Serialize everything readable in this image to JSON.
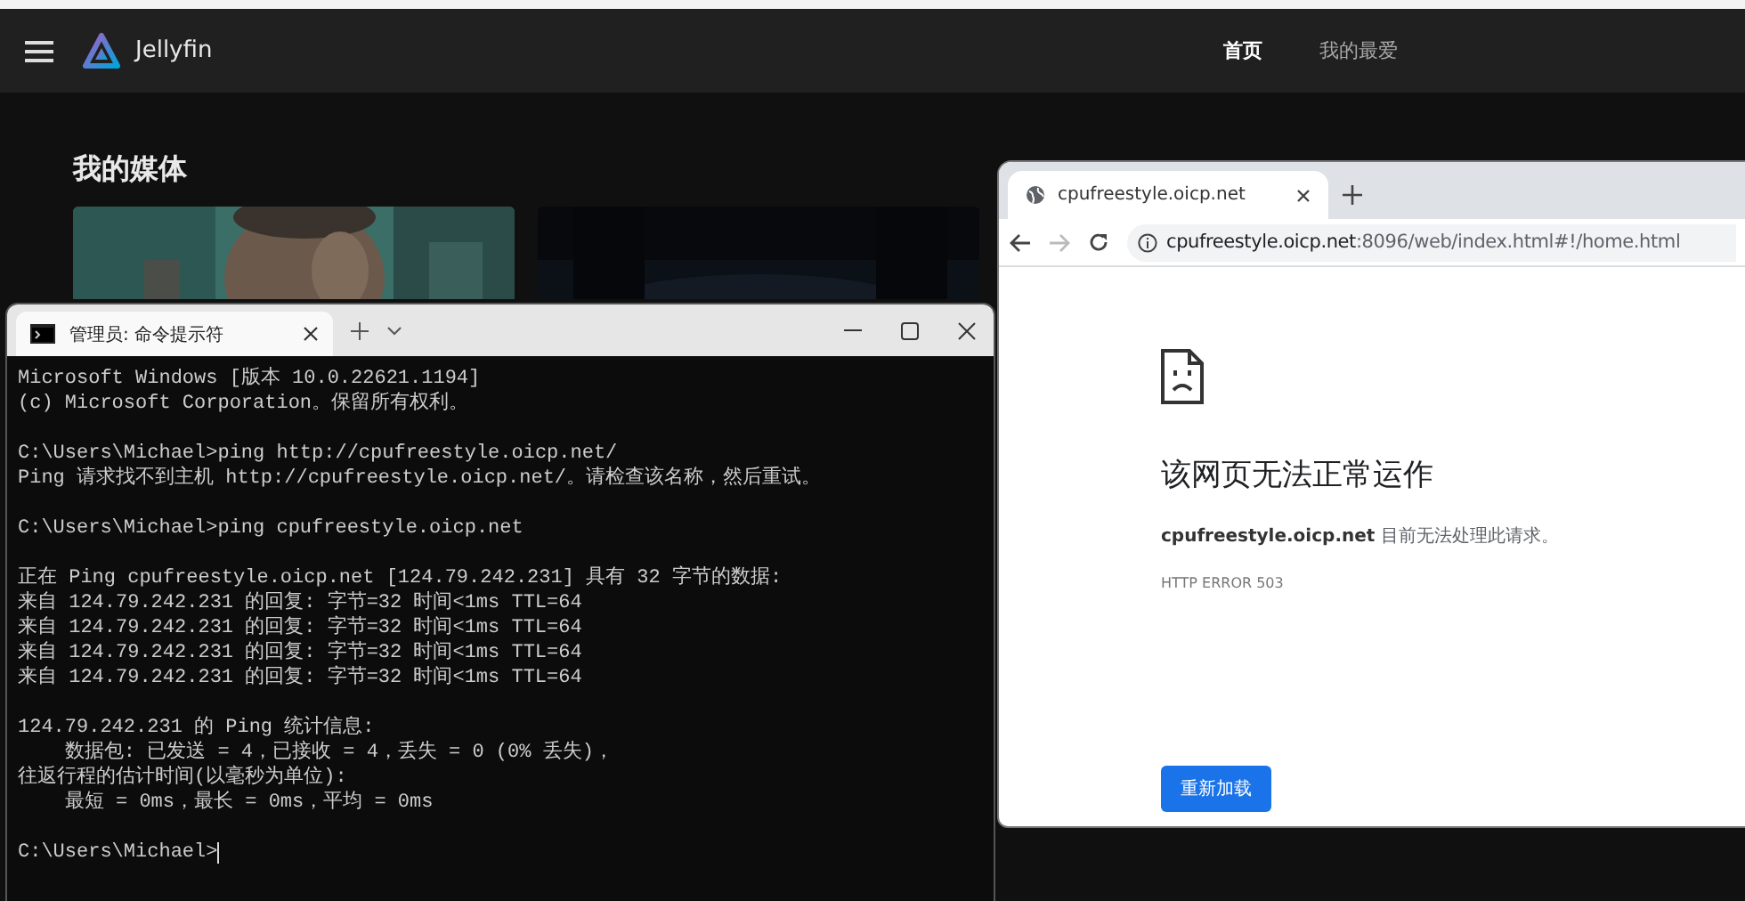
{
  "app": {
    "name": "Jellyfin",
    "nav": [
      {
        "label": "首页",
        "selected": true
      },
      {
        "label": "我的最爱",
        "selected": false
      }
    ],
    "section_title": "我的媒体"
  },
  "terminal": {
    "tab_title": "管理员: 命令提示符",
    "blocks": [
      [
        "Microsoft Windows [版本 10.0.22621.1194]",
        "(c) Microsoft Corporation。保留所有权利。"
      ],
      [
        "C:\\Users\\Michael>ping http://cpufreestyle.oicp.net/",
        "Ping 请求找不到主机 http://cpufreestyle.oicp.net/。请检查该名称，然后重试。"
      ],
      [
        "C:\\Users\\Michael>ping cpufreestyle.oicp.net"
      ],
      [
        "正在 Ping cpufreestyle.oicp.net [124.79.242.231] 具有 32 字节的数据:",
        "来自 124.79.242.231 的回复: 字节=32 时间<1ms TTL=64",
        "来自 124.79.242.231 的回复: 字节=32 时间<1ms TTL=64",
        "来自 124.79.242.231 的回复: 字节=32 时间<1ms TTL=64",
        "来自 124.79.242.231 的回复: 字节=32 时间<1ms TTL=64"
      ],
      [
        "124.79.242.231 的 Ping 统计信息:",
        "    数据包: 已发送 = 4，已接收 = 4，丢失 = 0 (0% 丢失)，",
        "往返行程的估计时间(以毫秒为单位):",
        "    最短 = 0ms，最长 = 0ms，平均 = 0ms"
      ]
    ],
    "prompt": "C:\\Users\\Michael>"
  },
  "browser": {
    "tab_title": "cpufreestyle.oicp.net",
    "url_host": "cpufreestyle.oicp.net",
    "url_rest": ":8096/web/index.html#!/home.html",
    "forward_disabled": true,
    "error": {
      "heading": "该网页无法正常运作",
      "host": "cpufreestyle.oicp.net",
      "message": "目前无法处理此请求。",
      "code": "HTTP ERROR 503"
    },
    "reload_button": "重新加载"
  }
}
